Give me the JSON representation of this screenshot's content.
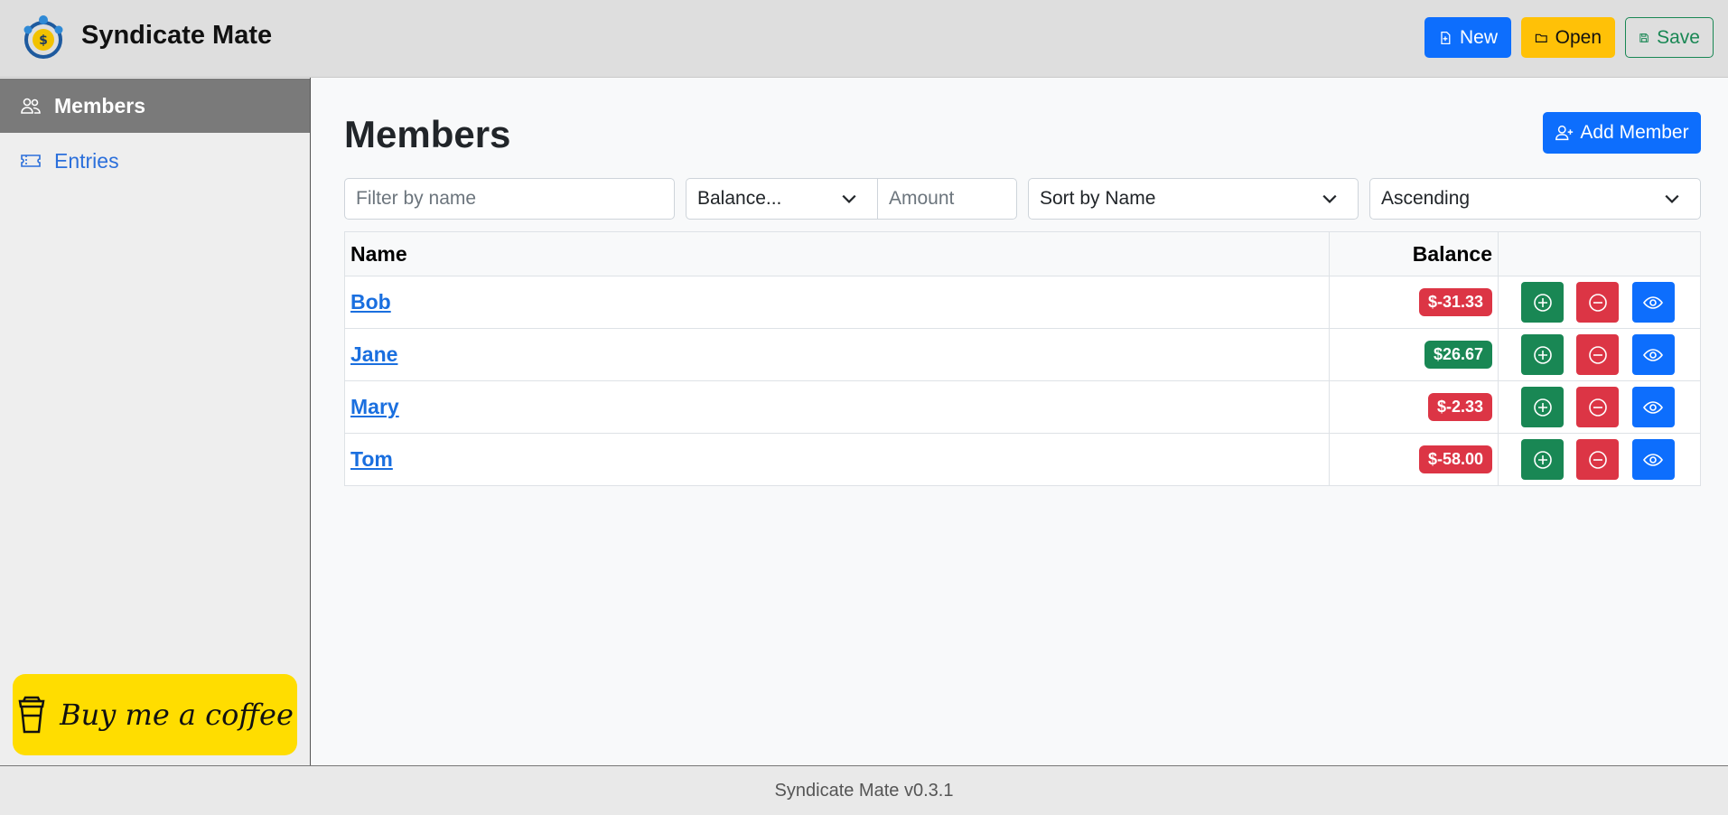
{
  "header": {
    "title": "Syndicate Mate",
    "new_label": "New",
    "open_label": "Open",
    "save_label": "Save"
  },
  "sidebar": {
    "items": [
      {
        "label": "Members",
        "icon": "people-icon",
        "active": true
      },
      {
        "label": "Entries",
        "icon": "ticket-icon",
        "active": false
      }
    ],
    "coffee_label": "Buy me a coffee"
  },
  "main": {
    "title": "Members",
    "add_label": "Add Member",
    "filters": {
      "name_placeholder": "Filter by name",
      "balance_selected": "Balance...",
      "amount_placeholder": "Amount",
      "sort_selected": "Sort by Name",
      "order_selected": "Ascending"
    },
    "table": {
      "columns": [
        "Name",
        "Balance",
        ""
      ],
      "rows": [
        {
          "name": "Bob",
          "balance": "$-31.33",
          "status": "negative"
        },
        {
          "name": "Jane",
          "balance": "$26.67",
          "status": "positive"
        },
        {
          "name": "Mary",
          "balance": "$-2.33",
          "status": "negative"
        },
        {
          "name": "Tom",
          "balance": "$-58.00",
          "status": "negative"
        }
      ]
    }
  },
  "footer": {
    "text": "Syndicate Mate v0.3.1"
  },
  "colors": {
    "primary": "#0d6efd",
    "warning": "#ffc107",
    "success": "#198754",
    "danger": "#dc3545",
    "coffee": "#ffdd00"
  }
}
